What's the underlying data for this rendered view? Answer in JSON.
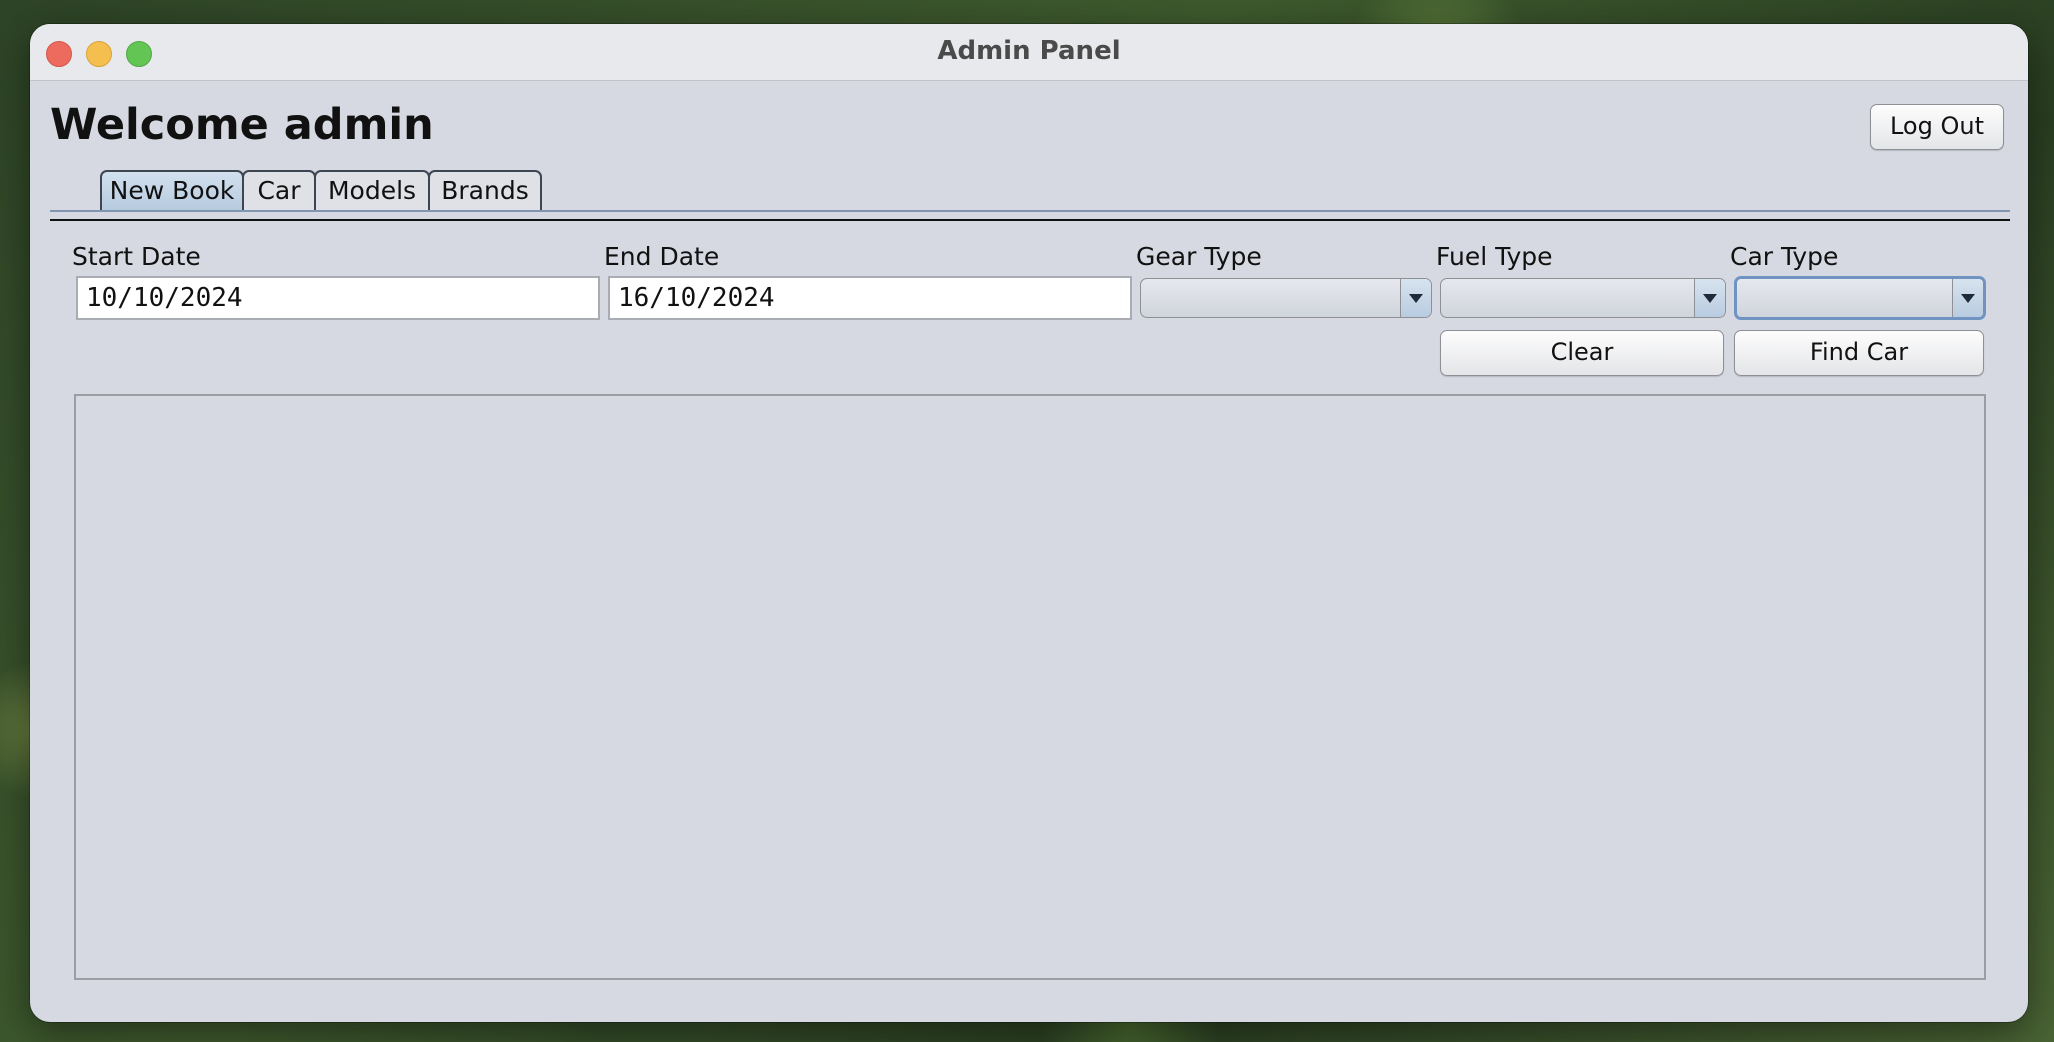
{
  "window": {
    "title": "Admin Panel"
  },
  "header": {
    "welcome": "Welcome admin",
    "logout_label": "Log Out"
  },
  "tabs": [
    {
      "label": "New Book",
      "active": true
    },
    {
      "label": "Car",
      "active": false
    },
    {
      "label": "Models",
      "active": false
    },
    {
      "label": "Brands",
      "active": false
    }
  ],
  "form": {
    "start_date_label": "Start Date",
    "start_date_value": "10/10/2024",
    "end_date_label": "End Date",
    "end_date_value": "16/10/2024",
    "gear_type_label": "Gear Type",
    "gear_type_value": "",
    "fuel_type_label": "Fuel Type",
    "fuel_type_value": "",
    "car_type_label": "Car Type",
    "car_type_value": ""
  },
  "actions": {
    "clear_label": "Clear",
    "find_label": "Find Car"
  },
  "results": {
    "rows": []
  },
  "colors": {
    "accent": "#6f94c2",
    "window_bg": "#d6d9e1"
  }
}
